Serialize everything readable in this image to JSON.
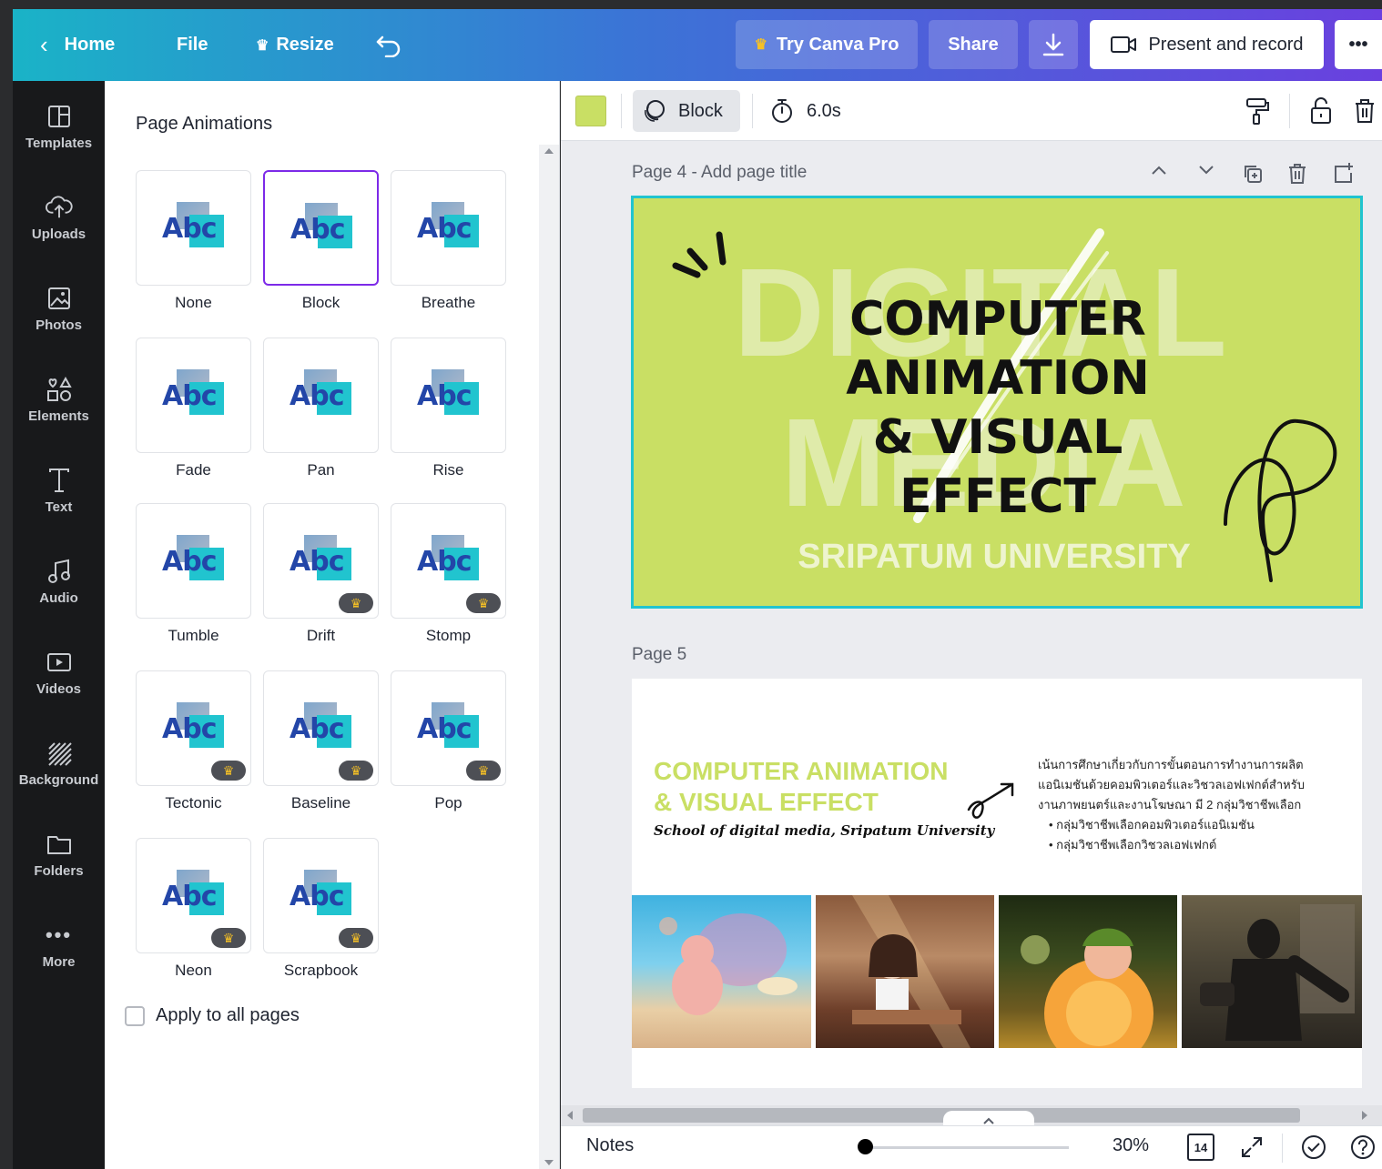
{
  "topbar": {
    "home": "Home",
    "file": "File",
    "resize": "Resize",
    "try_pro": "Try Canva Pro",
    "share": "Share",
    "present": "Present and record",
    "more": "•••"
  },
  "rail": {
    "items": [
      "Templates",
      "Uploads",
      "Photos",
      "Elements",
      "Text",
      "Audio",
      "Videos",
      "Background",
      "Folders",
      "More"
    ]
  },
  "panel": {
    "title": "Page Animations",
    "sample_text": "Abc",
    "animations": [
      {
        "label": "None",
        "pro": false,
        "selected": false
      },
      {
        "label": "Block",
        "pro": false,
        "selected": true
      },
      {
        "label": "Breathe",
        "pro": false,
        "selected": false
      },
      {
        "label": "Fade",
        "pro": false,
        "selected": false
      },
      {
        "label": "Pan",
        "pro": false,
        "selected": false
      },
      {
        "label": "Rise",
        "pro": false,
        "selected": false
      },
      {
        "label": "Tumble",
        "pro": false,
        "selected": false
      },
      {
        "label": "Drift",
        "pro": true,
        "selected": false
      },
      {
        "label": "Stomp",
        "pro": true,
        "selected": false
      },
      {
        "label": "Tectonic",
        "pro": true,
        "selected": false
      },
      {
        "label": "Baseline",
        "pro": true,
        "selected": false
      },
      {
        "label": "Pop",
        "pro": true,
        "selected": false
      },
      {
        "label": "Neon",
        "pro": true,
        "selected": false
      },
      {
        "label": "Scrapbook",
        "pro": true,
        "selected": false
      }
    ],
    "apply_all": "Apply to all pages"
  },
  "editor_toolbar": {
    "swatch_color": "#c9df64",
    "animation": "Block",
    "duration": "6.0s"
  },
  "page4": {
    "label": "Page 4 - Add page title",
    "bg_word1": "DIGITAL",
    "bg_word2": "MEDIA",
    "title_l1": "COMPUTER",
    "title_l2": "ANIMATION",
    "title_l3": "& VISUAL",
    "title_l4": "EFFECT",
    "subtitle": "SRIPATUM UNIVERSITY"
  },
  "page5": {
    "label": "Page 5",
    "heading_l1": "COMPUTER ANIMATION",
    "heading_l2": "& VISUAL EFFECT",
    "script": "School of digital media, Sripatum University",
    "desc_l1": "เน้นการศึกษาเกี่ยวกับการขั้นตอนการทำงานการผลิต",
    "desc_l2": "แอนิเมชันด้วยคอมพิวเตอร์และวิชวลเอฟเฟกต์สำหรับ",
    "desc_l3": "งานภาพยนตร์และงานโฆษณา มี 2 กลุ่มวิชาชีพเลือก",
    "bullet1": "กลุ่มวิชาชีพเลือกคอมพิวเตอร์แอนิเมชัน",
    "bullet2": "กลุ่มวิชาชีพเลือกวิชวลเอฟเฟกต์"
  },
  "bottombar": {
    "notes": "Notes",
    "zoom": "30%",
    "page_count": "14"
  }
}
